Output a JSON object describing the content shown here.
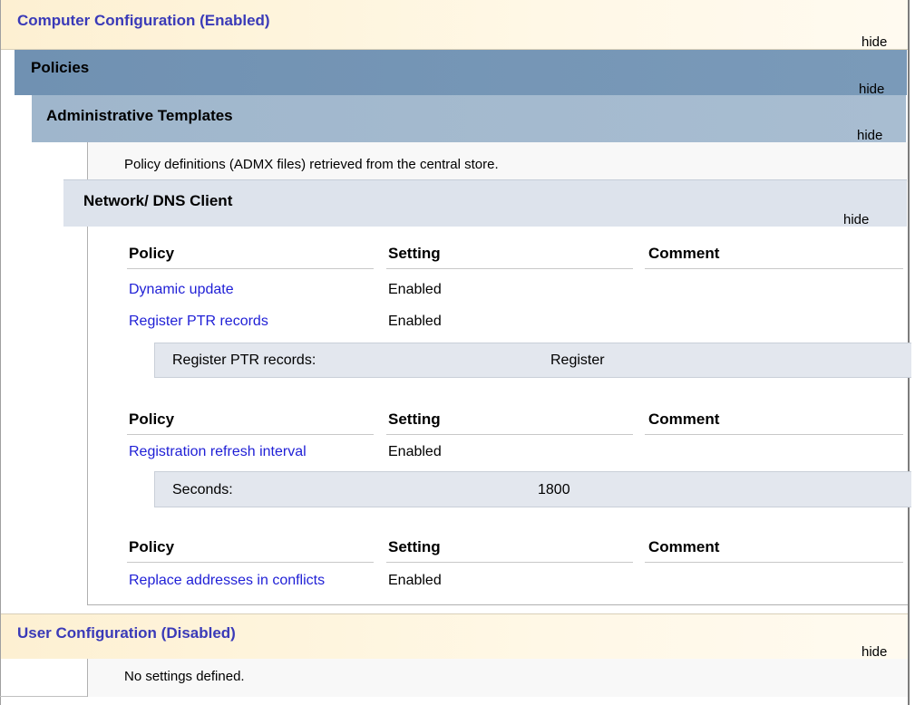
{
  "computer_config": {
    "title": "Computer Configuration (Enabled)",
    "hide": "hide"
  },
  "policies": {
    "title": "Policies",
    "hide": "hide"
  },
  "admin_templates": {
    "title": "Administrative Templates",
    "hide": "hide",
    "description": "Policy definitions (ADMX files) retrieved from the central store."
  },
  "dns_client": {
    "title": "Network/ DNS Client",
    "hide": "hide"
  },
  "table_headers": {
    "policy": "Policy",
    "setting": "Setting",
    "comment": "Comment"
  },
  "policy_groups": [
    {
      "rows": [
        {
          "policy": "Dynamic update",
          "setting": "Enabled",
          "comment": ""
        },
        {
          "policy": "Register PTR records",
          "setting": "Enabled",
          "comment": ""
        }
      ],
      "detail": {
        "label": "Register PTR records:",
        "value": "Register"
      }
    },
    {
      "rows": [
        {
          "policy": "Registration refresh interval",
          "setting": "Enabled",
          "comment": ""
        }
      ],
      "detail": {
        "label": "Seconds:",
        "value": "1800"
      }
    },
    {
      "rows": [
        {
          "policy": "Replace addresses in conflicts",
          "setting": "Enabled",
          "comment": ""
        }
      ]
    }
  ],
  "user_config": {
    "title": "User Configuration (Disabled)",
    "hide": "hide",
    "description": "No settings defined."
  },
  "colors": {
    "config_title": "#3a3ab8",
    "policy_link": "#1f1fd6",
    "policies_band": "#7091b2",
    "admin_band": "#9fb6cc",
    "dns_band": "#dde3ec",
    "detail_band": "#e3e7ee"
  }
}
